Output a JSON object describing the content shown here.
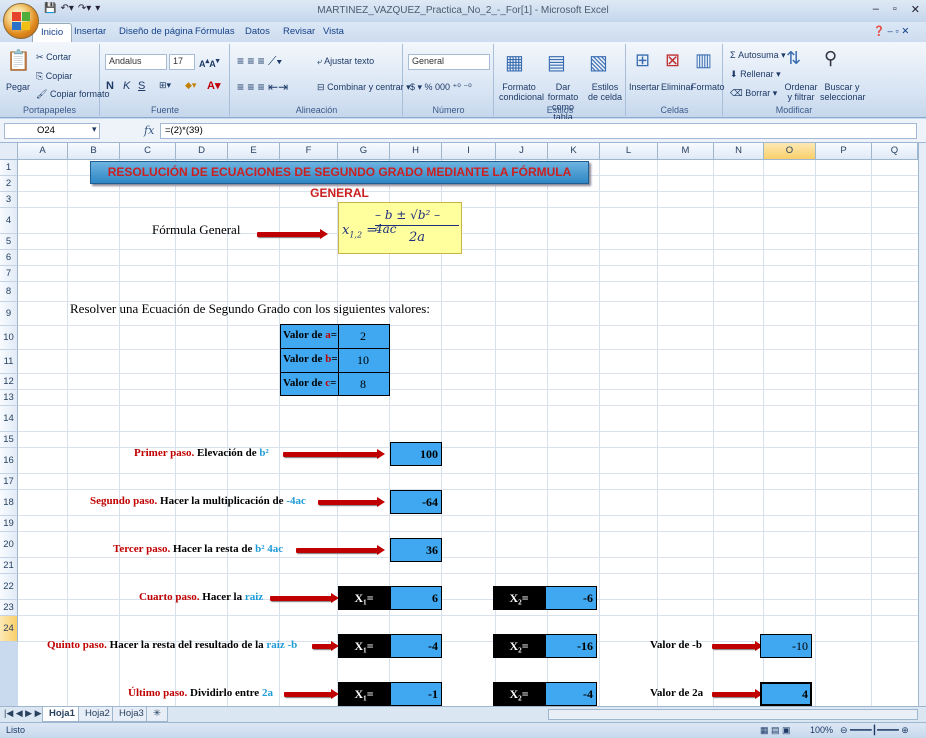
{
  "window": {
    "title": "MARTINEZ_VAZQUEZ_Practica_No_2_-_For[1] - Microsoft Excel",
    "controls": [
      "–",
      "▫",
      "✕"
    ]
  },
  "ribbon_tabs": [
    "Inicio",
    "Insertar",
    "Diseño de página",
    "Fórmulas",
    "Datos",
    "Revisar",
    "Vista"
  ],
  "ribbon": {
    "clipboard": {
      "paste": "Pegar",
      "cut": "Cortar",
      "copy": "Copiar",
      "format_painter": "Copiar formato",
      "label": "Portapapeles"
    },
    "font": {
      "name": "Andalus",
      "size": "17",
      "label": "Fuente"
    },
    "alignment": {
      "wrap": "Ajustar texto",
      "merge": "Combinar y centrar",
      "label": "Alineación"
    },
    "number": {
      "format": "General",
      "label": "Número"
    },
    "styles": {
      "cond": "Formato condicional",
      "table": "Dar formato como tabla",
      "cell": "Estilos de celda",
      "label": "Estilos"
    },
    "cells": {
      "insert": "Insertar",
      "delete": "Eliminar",
      "format": "Formato",
      "label": "Celdas"
    },
    "editing": {
      "autosum": "Autosuma",
      "fill": "Rellenar",
      "clear": "Borrar",
      "sort": "Ordenar y filtrar",
      "find": "Buscar y seleccionar",
      "label": "Modificar"
    }
  },
  "formula_bar": {
    "name_box": "O24",
    "fx": "fx",
    "formula": "=(2)*(39)"
  },
  "columns": [
    "A",
    "B",
    "C",
    "D",
    "E",
    "F",
    "G",
    "H",
    "I",
    "J",
    "K",
    "L",
    "M",
    "N",
    "O",
    "P",
    "Q"
  ],
  "rows": [
    "1",
    "2",
    "3",
    "4",
    "5",
    "6",
    "7",
    "8",
    "9",
    "10",
    "11",
    "12",
    "13",
    "14",
    "15",
    "16",
    "17",
    "18",
    "19",
    "20",
    "21",
    "22",
    "23",
    "24"
  ],
  "sheet": {
    "banner": "RESOLUCIÓN DE ECUACIONES DE SEGUNDO GRADO MEDIANTE LA FÓRMULA GENERAL",
    "formula_label": "Fórmula General",
    "formula": {
      "lhs": "x",
      "lhs_sub": "1,2",
      "num": "– b ± √b² – 4ac",
      "den": "2a"
    },
    "intro": "Resolver una Ecuación de Segundo Grado con los siguientes valores:",
    "inputs": [
      {
        "label_pre": "Valor de ",
        "var": "a",
        "label_post": "=",
        "value": "2"
      },
      {
        "label_pre": "Valor de ",
        "var": "b",
        "label_post": "=",
        "value": "10"
      },
      {
        "label_pre": "Valor de ",
        "var": "c",
        "label_post": "=",
        "value": "8"
      }
    ],
    "step1": {
      "lead": "Primer paso.",
      "text": " Elevación de ",
      "term": "b²",
      "value": "100"
    },
    "step2": {
      "lead": "Segundo paso.",
      "text": " Hacer la multiplicación de ",
      "term": "-4ac",
      "value": "-64"
    },
    "step3": {
      "lead": "Tercer paso.",
      "text": " Hacer la resta de ",
      "term": "b² 4ac",
      "value": "36"
    },
    "step4": {
      "lead": "Cuarto paso.",
      "text": " Hacer la ",
      "term": "raiz",
      "x1_label": "X₁=",
      "x1": "6",
      "x2_label": "X₂=",
      "x2": "-6"
    },
    "step5": {
      "lead": "Quinto paso.",
      "text": " Hacer la resta del resultado de la ",
      "term": "raiz -b",
      "x1_label": "X₁=",
      "x1": "-4",
      "x2_label": "X₂=",
      "x2": "-16",
      "side_label": "Valor de -b",
      "side_value": "-10"
    },
    "step6": {
      "lead": "Último paso.",
      "text": " Dividirlo entre ",
      "term": "2a",
      "x1_label": "X₁=",
      "x1": "-1",
      "x2_label": "X₂=",
      "x2": "-4",
      "side_label": "Valor de 2a",
      "side_value": "4"
    }
  },
  "sheet_tabs": [
    "Hoja1",
    "Hoja2",
    "Hoja3"
  ],
  "status": {
    "left": "Listo",
    "zoom": "100%"
  }
}
